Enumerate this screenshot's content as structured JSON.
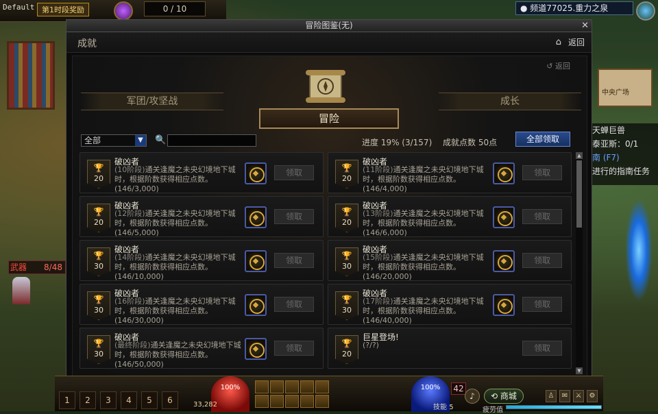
{
  "hud": {
    "player_label": "Default",
    "stage_badge": "第1时段奖励",
    "quest_count": "0 / 10",
    "channel": "频道77025.重力之泉",
    "right_panel": {
      "map_note": "中央广场",
      "lines": [
        "天蝉巨兽",
        "泰亚斯：0/1",
        "南 (F7)",
        "进行的指南任务"
      ]
    },
    "weapon_label": "武器",
    "weapon_count": "8/48",
    "hp_percent": "100%",
    "mp_percent": "100%",
    "gold": "33,282",
    "level": "42",
    "skill_points_label": "技能",
    "skill_points": "5",
    "shop_label": "商城",
    "fatigue_label": "疲劳值",
    "fatigue_fraction": 1.0,
    "potion_slots": [
      "1",
      "2",
      "3",
      "4",
      "5",
      "6"
    ]
  },
  "window": {
    "title": "冒险图鉴(无)",
    "close_icon": "close-icon",
    "section_title": "成就",
    "back_label": "返回",
    "inner_back_label": "返回",
    "categories": {
      "left": "军团/攻坚战",
      "center": "冒险",
      "right": "成长"
    },
    "filter": {
      "select_value": "全部",
      "search_placeholder": "",
      "progress_text": "进度  19% (3/157)",
      "points_text": "成就点数 50点",
      "claim_all_label": "全部领取"
    },
    "claim_label": "领取",
    "achievements": [
      {
        "name": "破凶者",
        "points": "20",
        "stage": "(10阶段)",
        "desc": "通关逢魔之未央幻境地下城时，根据阶数获得相应点数。",
        "progress": "(146/3,000)"
      },
      {
        "name": "破凶者",
        "points": "20",
        "stage": "(11阶段)",
        "desc": "通关逢魔之未央幻境地下城时，根据阶数获得相应点数。",
        "progress": "(146/4,000)"
      },
      {
        "name": "破凶者",
        "points": "20",
        "stage": "(12阶段)",
        "desc": "通关逢魔之未央幻境地下城时，根据阶数获得相应点数。",
        "progress": "(146/5,000)"
      },
      {
        "name": "破凶者",
        "points": "20",
        "stage": "(13阶段)",
        "desc": "通关逢魔之未央幻境地下城时，根据阶数获得相应点数。",
        "progress": "(146/6,000)"
      },
      {
        "name": "破凶者",
        "points": "30",
        "stage": "(14阶段)",
        "desc": "通关逢魔之未央幻境地下城时，根据阶数获得相应点数。",
        "progress": "(146/10,000)"
      },
      {
        "name": "破凶者",
        "points": "30",
        "stage": "(15阶段)",
        "desc": "通关逢魔之未央幻境地下城时，根据阶数获得相应点数。",
        "progress": "(146/20,000)"
      },
      {
        "name": "破凶者",
        "points": "30",
        "stage": "(16阶段)",
        "desc": "通关逢魔之未央幻境地下城时，根据阶数获得相应点数。",
        "progress": "(146/30,000)"
      },
      {
        "name": "破凶者",
        "points": "30",
        "stage": "(17阶段)",
        "desc": "通关逢魔之未央幻境地下城时，根据阶数获得相应点数。",
        "progress": "(146/40,000)"
      },
      {
        "name": "破凶者",
        "points": "30",
        "stage": "(最终阶段)",
        "desc": "通关逢魔之未央幻境地下城时，根据阶数获得相应点数。",
        "progress": "(146/50,000)"
      },
      {
        "name": "巨星登场!",
        "points": "20",
        "stage": "",
        "desc": "(?/?)",
        "progress": ""
      }
    ]
  }
}
